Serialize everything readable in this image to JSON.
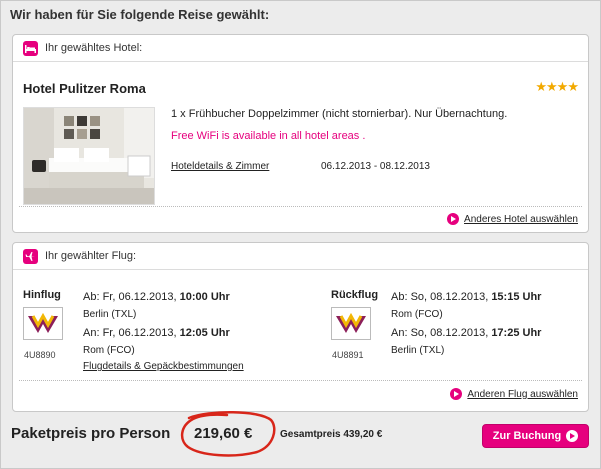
{
  "page_title": "Wir haben für Sie folgende Reise gewählt:",
  "hotel": {
    "header_label": "Ihr gewähltes Hotel:",
    "name": "Hotel Pulitzer Roma",
    "stars": "★★★★",
    "room_description": "1 x Frühbucher Doppelzimmer (nicht stornierbar). Nur Übernachtung.",
    "wifi_note": "Free WiFi is available in all hotel areas .",
    "details_link": "Hoteldetails & Zimmer",
    "dates": "06.12.2013 - 08.12.2013",
    "change_link": "Anderes Hotel auswählen",
    "header_icon": "bed-icon",
    "photo": "hotel-room-photo"
  },
  "flight": {
    "header_label": "Ihr gewählter Flug:",
    "header_icon": "plane-icon",
    "outbound": {
      "title": "Hinflug",
      "dep_prefix": "Ab: Fr, 06.12.2013, ",
      "dep_time": "10:00 Uhr",
      "dep_city": "Berlin (TXL)",
      "arr_prefix": "An: Fr, 06.12.2013, ",
      "arr_time": "12:05 Uhr",
      "arr_city": "Rom (FCO)",
      "flight_number": "4U8890",
      "airline_logo": "germanwings-logo"
    },
    "inbound": {
      "title": "Rückflug",
      "dep_prefix": "Ab: So, 08.12.2013, ",
      "dep_time": "15:15 Uhr",
      "dep_city": "Rom (FCO)",
      "arr_prefix": "An: So, 08.12.2013, ",
      "arr_time": "17:25 Uhr",
      "arr_city": "Berlin (TXL)",
      "flight_number": "4U8891",
      "airline_logo": "germanwings-logo"
    },
    "details_link": "Flugdetails & Gepäckbestimmungen",
    "change_link": "Anderen Flug auswählen"
  },
  "summary": {
    "package_label": "Paketpreis pro Person",
    "package_price": "219,60 €",
    "total_label": "Gesamtpreis 439,20 €",
    "booking_button": "Zur Buchung"
  },
  "colors": {
    "accent": "#e6007e",
    "stars": "#f2a900",
    "annotation_ring": "#d8261a"
  }
}
